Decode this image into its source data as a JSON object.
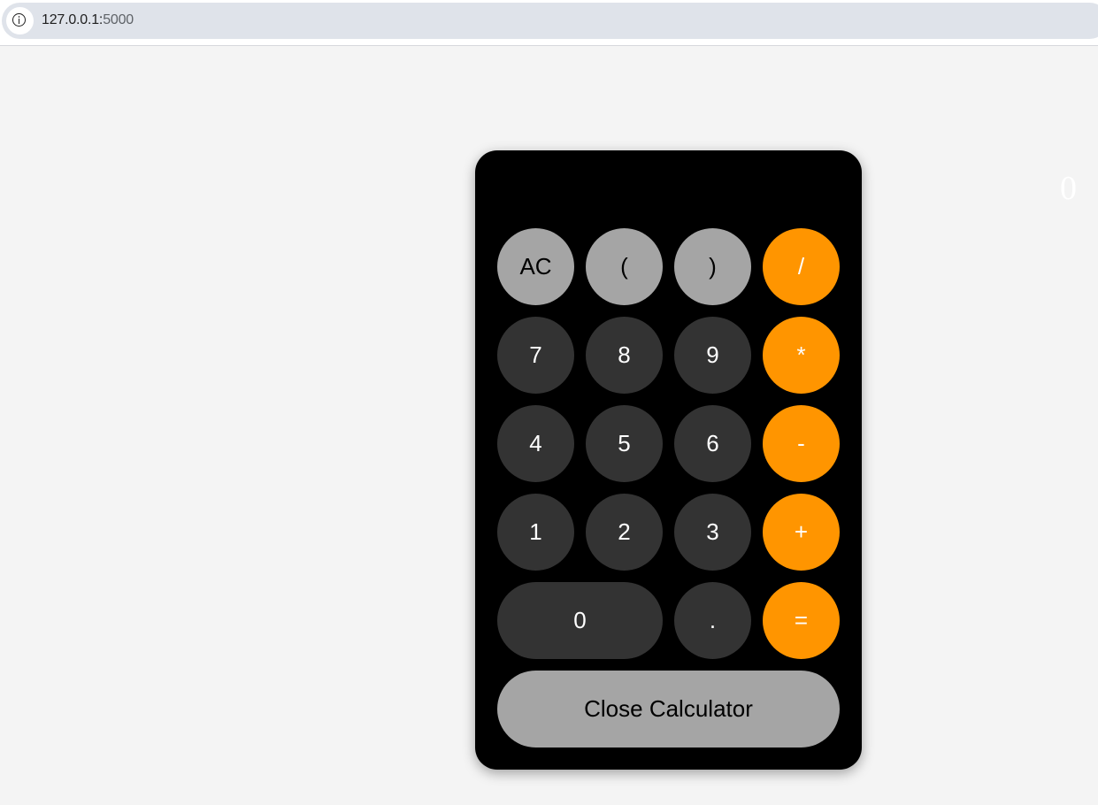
{
  "browser": {
    "url_host": "127.0.0.1:",
    "url_port": "5000"
  },
  "calculator": {
    "display": "0",
    "keys": {
      "clear": "AC",
      "open_paren": "(",
      "close_paren": ")",
      "divide": "/",
      "seven": "7",
      "eight": "8",
      "nine": "9",
      "multiply": "*",
      "four": "4",
      "five": "5",
      "six": "6",
      "subtract": "-",
      "one": "1",
      "two": "2",
      "three": "3",
      "add": "+",
      "zero": "0",
      "decimal": ".",
      "equals": "="
    },
    "close_label": "Close Calculator"
  },
  "colors": {
    "page_background": "#f4f4f4",
    "calculator_body": "#000000",
    "function_key": "#a5a5a5",
    "digit_key": "#333333",
    "operator_key": "#ff9500"
  },
  "icons": {
    "site_info": "info-icon"
  }
}
